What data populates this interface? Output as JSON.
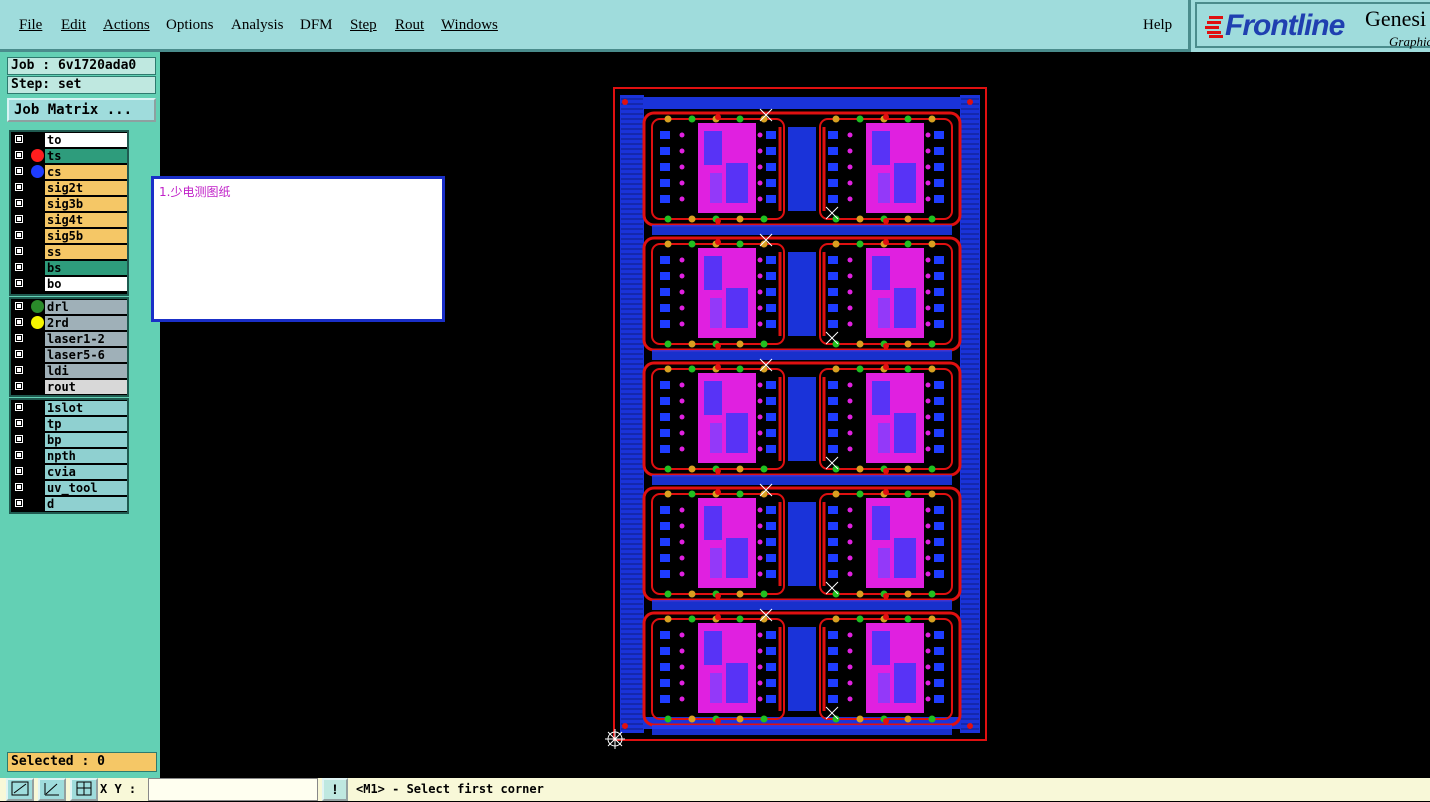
{
  "menu": {
    "items": [
      "File",
      "Edit",
      "Actions",
      "Options",
      "Analysis",
      "DFM",
      "Step",
      "Rout",
      "Windows"
    ],
    "help": "Help"
  },
  "branding": {
    "logo": "Frontline",
    "product": "Genesi",
    "subtitle": "Graphic"
  },
  "job": {
    "label": "Job : 6v1720ada0",
    "step": "Step: set",
    "matrix_button": "Job Matrix ..."
  },
  "layers": {
    "board": [
      {
        "name": "to",
        "color": "#ffffff",
        "dot": ""
      },
      {
        "name": "ts",
        "color": "#2e9c7c",
        "dot": "#ff1e1e",
        "selected": true
      },
      {
        "name": "cs",
        "color": "#f5c766",
        "dot": "#1e3cff"
      },
      {
        "name": "sig2t",
        "color": "#f5c766",
        "dot": ""
      },
      {
        "name": "sig3b",
        "color": "#f5c766",
        "dot": ""
      },
      {
        "name": "sig4t",
        "color": "#f5c766",
        "dot": ""
      },
      {
        "name": "sig5b",
        "color": "#f5c766",
        "dot": ""
      },
      {
        "name": "ss",
        "color": "#f5c766",
        "dot": ""
      },
      {
        "name": "bs",
        "color": "#2e9c7c",
        "dot": ""
      },
      {
        "name": "bo",
        "color": "#ffffff",
        "dot": ""
      }
    ],
    "drill": [
      {
        "name": "drl",
        "color": "#9fb0b8",
        "dot": "#2a8a2a"
      },
      {
        "name": "2rd",
        "color": "#9fb0b8",
        "dot": "#f5f500"
      },
      {
        "name": "laser1-2",
        "color": "#9fb0b8",
        "dot": ""
      },
      {
        "name": "laser5-6",
        "color": "#9fb0b8",
        "dot": ""
      },
      {
        "name": "ldi",
        "color": "#9fb0b8",
        "dot": ""
      },
      {
        "name": "rout",
        "color": "#d8d8d8",
        "dot": ""
      }
    ],
    "misc": [
      {
        "name": "1slot",
        "color": "#8fd0d0",
        "dot": ""
      },
      {
        "name": "tp",
        "color": "#8fd0d0",
        "dot": ""
      },
      {
        "name": "bp",
        "color": "#8fd0d0",
        "dot": ""
      },
      {
        "name": "npth",
        "color": "#8fd0d0",
        "dot": ""
      },
      {
        "name": "cvia",
        "color": "#8fd0d0",
        "dot": ""
      },
      {
        "name": "uv_tool",
        "color": "#8fd0d0",
        "dot": ""
      },
      {
        "name": "d",
        "color": "#8fd0d0",
        "dot": ""
      }
    ]
  },
  "selected": "Selected : 0",
  "note": "1.少电测图纸",
  "status": {
    "xy_label": "X Y :",
    "xy_value": "",
    "warn": "!",
    "prompt": "<M1> - Select first corner"
  },
  "colors": {
    "panel": "#63d0b4",
    "menubar": "#9fdcdc",
    "board_outline": "#e01010",
    "copper": "#1e3cff",
    "pads": "#e020e0"
  }
}
